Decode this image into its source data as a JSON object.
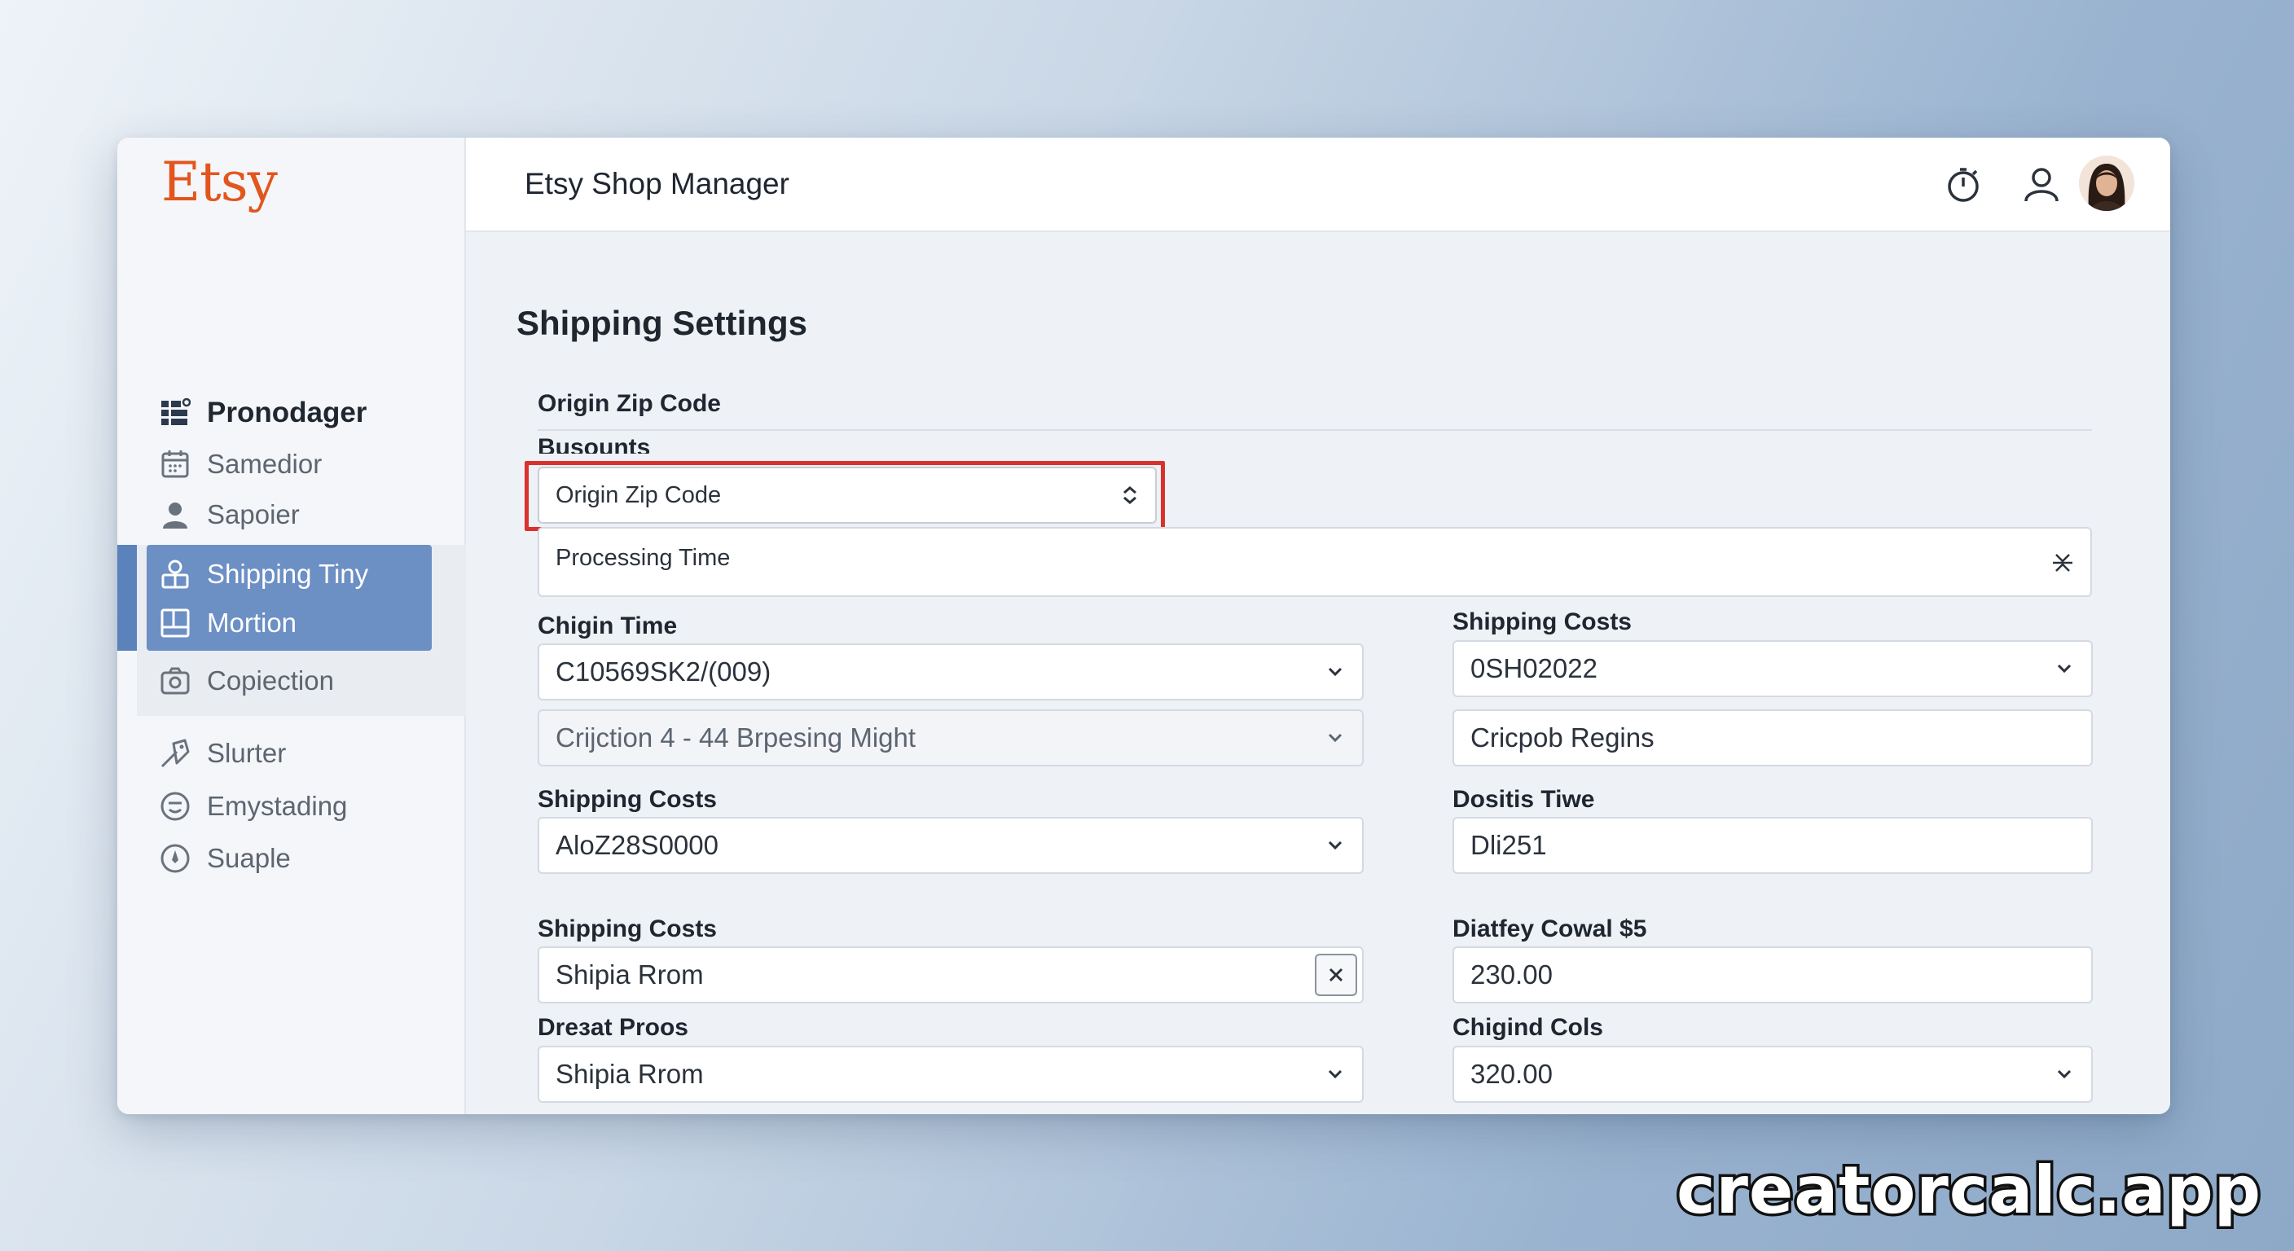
{
  "app": {
    "logo": "Etsy",
    "title": "Etsy Shop Manager"
  },
  "sidebar": {
    "items": [
      {
        "label": "Pronodager",
        "icon": "grid-icon"
      },
      {
        "label": "Samedior",
        "icon": "calendar-icon"
      },
      {
        "label": "Sapoier",
        "icon": "user-icon"
      },
      {
        "label": "Shipping Tiny",
        "icon": "shipping-icon"
      },
      {
        "label": "Mortion",
        "icon": "layout-icon"
      },
      {
        "label": "Copiection",
        "icon": "camera-icon"
      },
      {
        "label": "Slurter",
        "icon": "tag-icon"
      },
      {
        "label": "Emystading",
        "icon": "smile-icon"
      },
      {
        "label": "Suaple",
        "icon": "compass-icon"
      }
    ]
  },
  "header": {
    "icons": [
      "timer-icon",
      "profile-icon",
      "avatar"
    ]
  },
  "main": {
    "title": "Shipping Settings",
    "origin_label": "Origin Zip Code",
    "sub_label": "Busounts",
    "origin_select": "Origin Zip Code",
    "processing_field": "Processing Time",
    "left": {
      "f1_label": "Chigin Time",
      "f1_value": "C10569SK2/(009)",
      "f2_value": "Crijction 4 - 44 Brpesing Might",
      "f3_label": "Shipping Costs",
      "f3_value": "AloZ28S0000",
      "f4_label": "Shipping Costs",
      "f4_value": "Shipia Rrom",
      "f5_label": "Dreɜat Proos",
      "f5_value": "Shipia Rrom"
    },
    "right": {
      "f1_label": "Shipping Costs",
      "f1_value": "0SH02022",
      "f2_value": "Cricpob Regins",
      "f3_label": "Dositis Tiwe",
      "f3_value": "Dli251",
      "f4_label": "Diatfey Cowal  $5",
      "f4_value": "230.00",
      "f5_label": "Chigind Cols",
      "f5_value": "320.00"
    }
  },
  "watermark": "creatorcalc.app",
  "colors": {
    "brand": "#e2561d",
    "active": "#6c8fc4",
    "highlight": "#d9312b"
  }
}
